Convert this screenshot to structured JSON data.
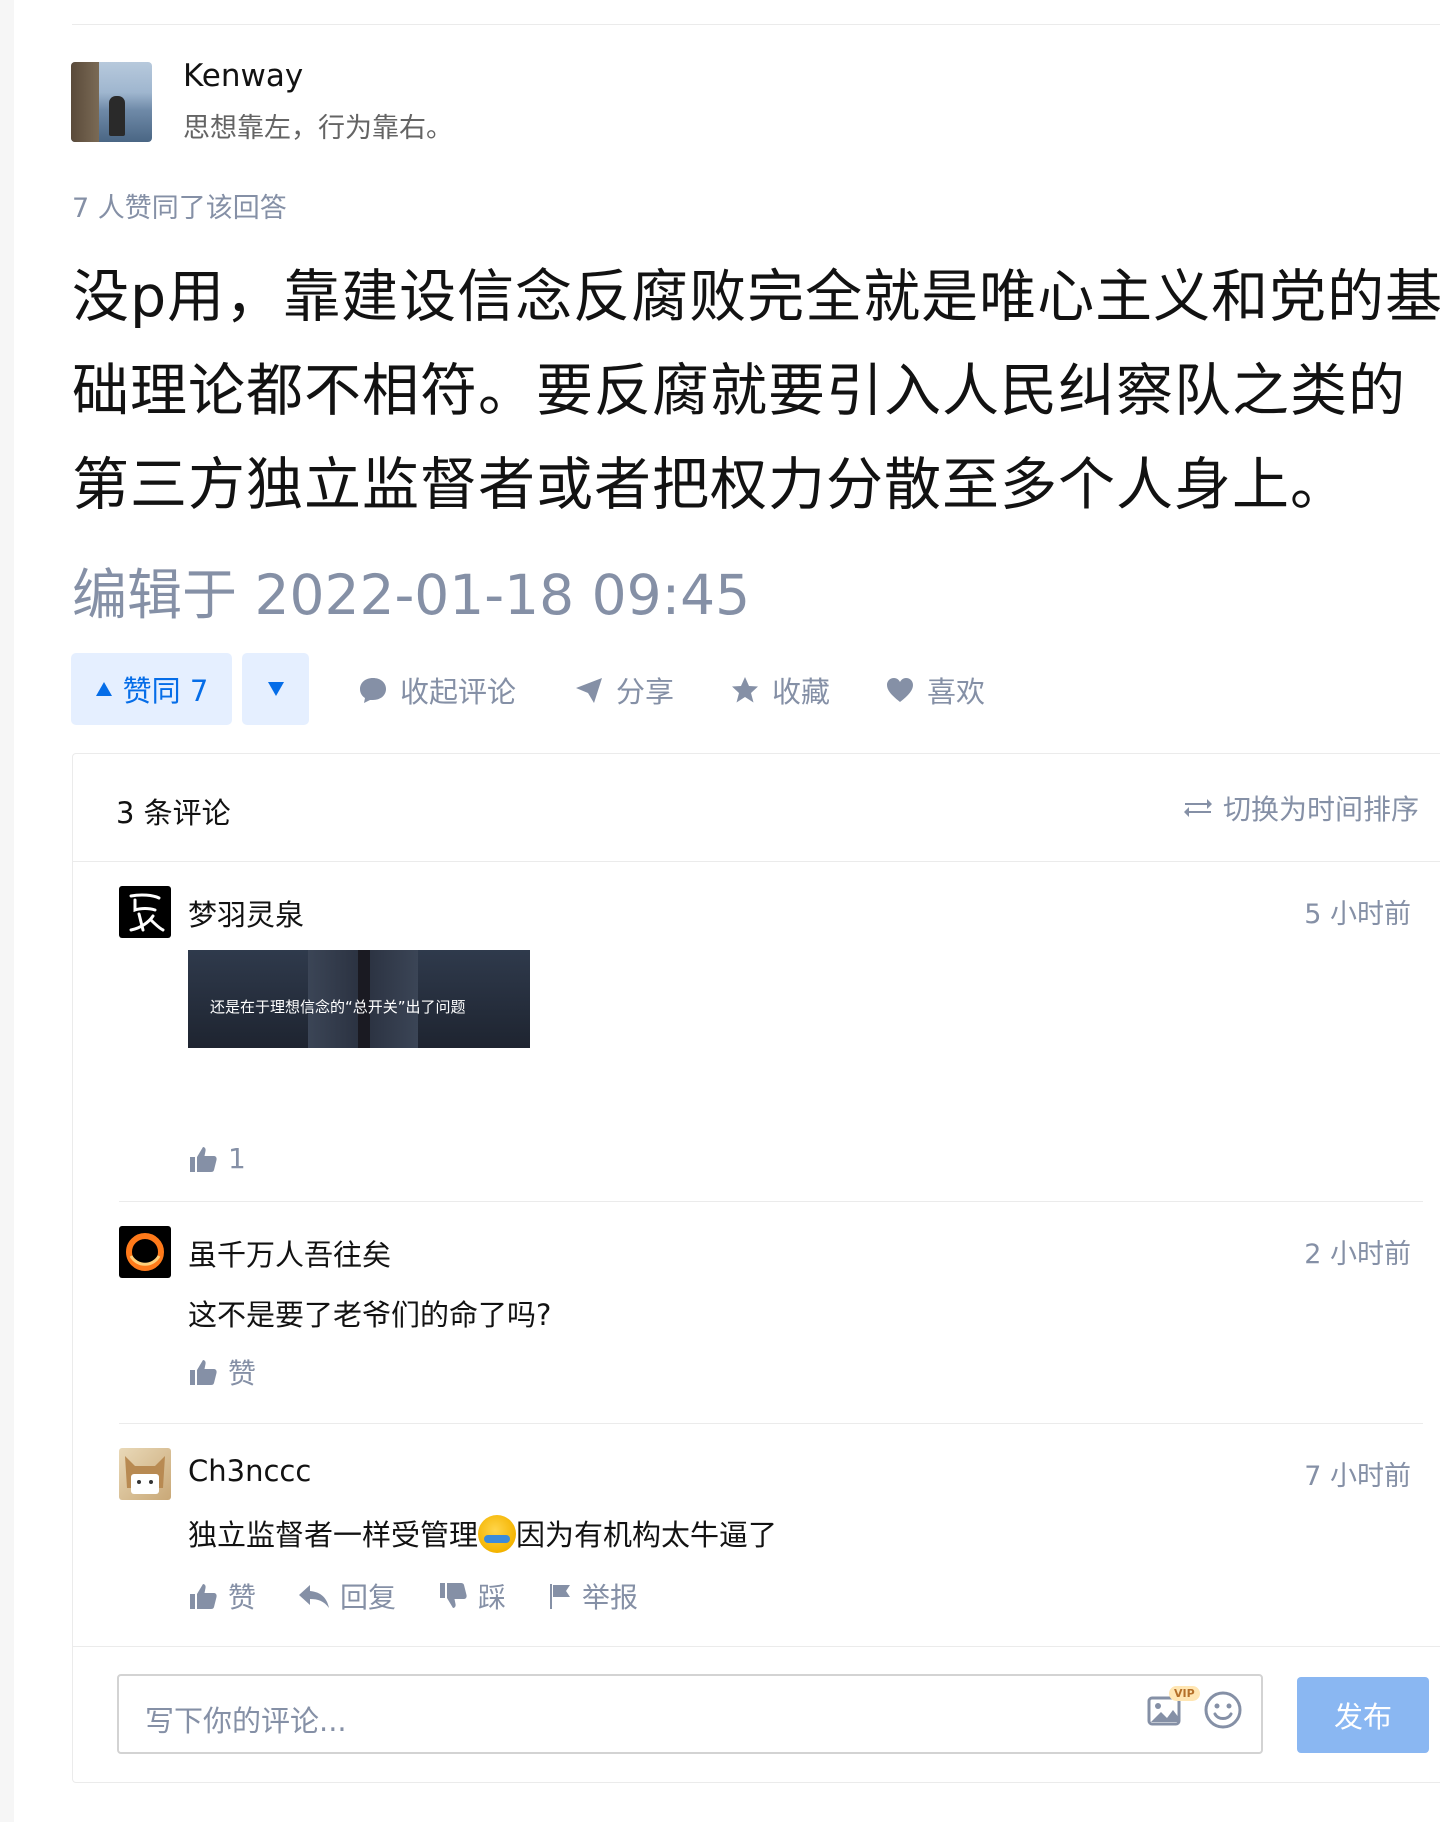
{
  "author": {
    "name": "Kenway",
    "bio": "思想靠左，行为靠右。"
  },
  "answer": {
    "votes_summary": "7 人赞同了该回答",
    "body": "没p用，靠建设信念反腐败完全就是唯心主义和党的基础理论都不相符。要反腐就要引入人民纠察队之类的第三方独立监督者或者把权力分散至多个人身上。",
    "edited": "编辑于 2022-01-18 09:45"
  },
  "actions": {
    "upvote_label": "赞同 7",
    "collapse_comments": "收起评论",
    "share": "分享",
    "collect": "收藏",
    "like": "喜欢"
  },
  "comments": {
    "count_label": "3 条评论",
    "sort_toggle": "切换为时间排序",
    "items": [
      {
        "name": "梦羽灵泉",
        "time": "5 小时前",
        "image_caption": "还是在于理想信念的“总开关”出了问题",
        "like_label": "1"
      },
      {
        "name": "虽千万人吾往矣",
        "time": "2 小时前",
        "text": "这不是要了老爷们的命了吗?",
        "like_label": "赞"
      },
      {
        "name": "Ch3nccc",
        "time": "7 小时前",
        "text_before_emoji": "独立监督者一样受管理",
        "text_after_emoji": "因为有机构太牛逼了",
        "like_label": "赞",
        "reply_label": "回复",
        "dislike_label": "踩",
        "report_label": "举报"
      }
    ],
    "input_placeholder": "写下你的评论...",
    "vip_badge": "VIP",
    "submit_label": "发布"
  },
  "colors": {
    "accent": "#056de8",
    "muted": "#8590a6",
    "vote_bg": "#e5efff",
    "submit_disabled": "#8ab7f2"
  }
}
